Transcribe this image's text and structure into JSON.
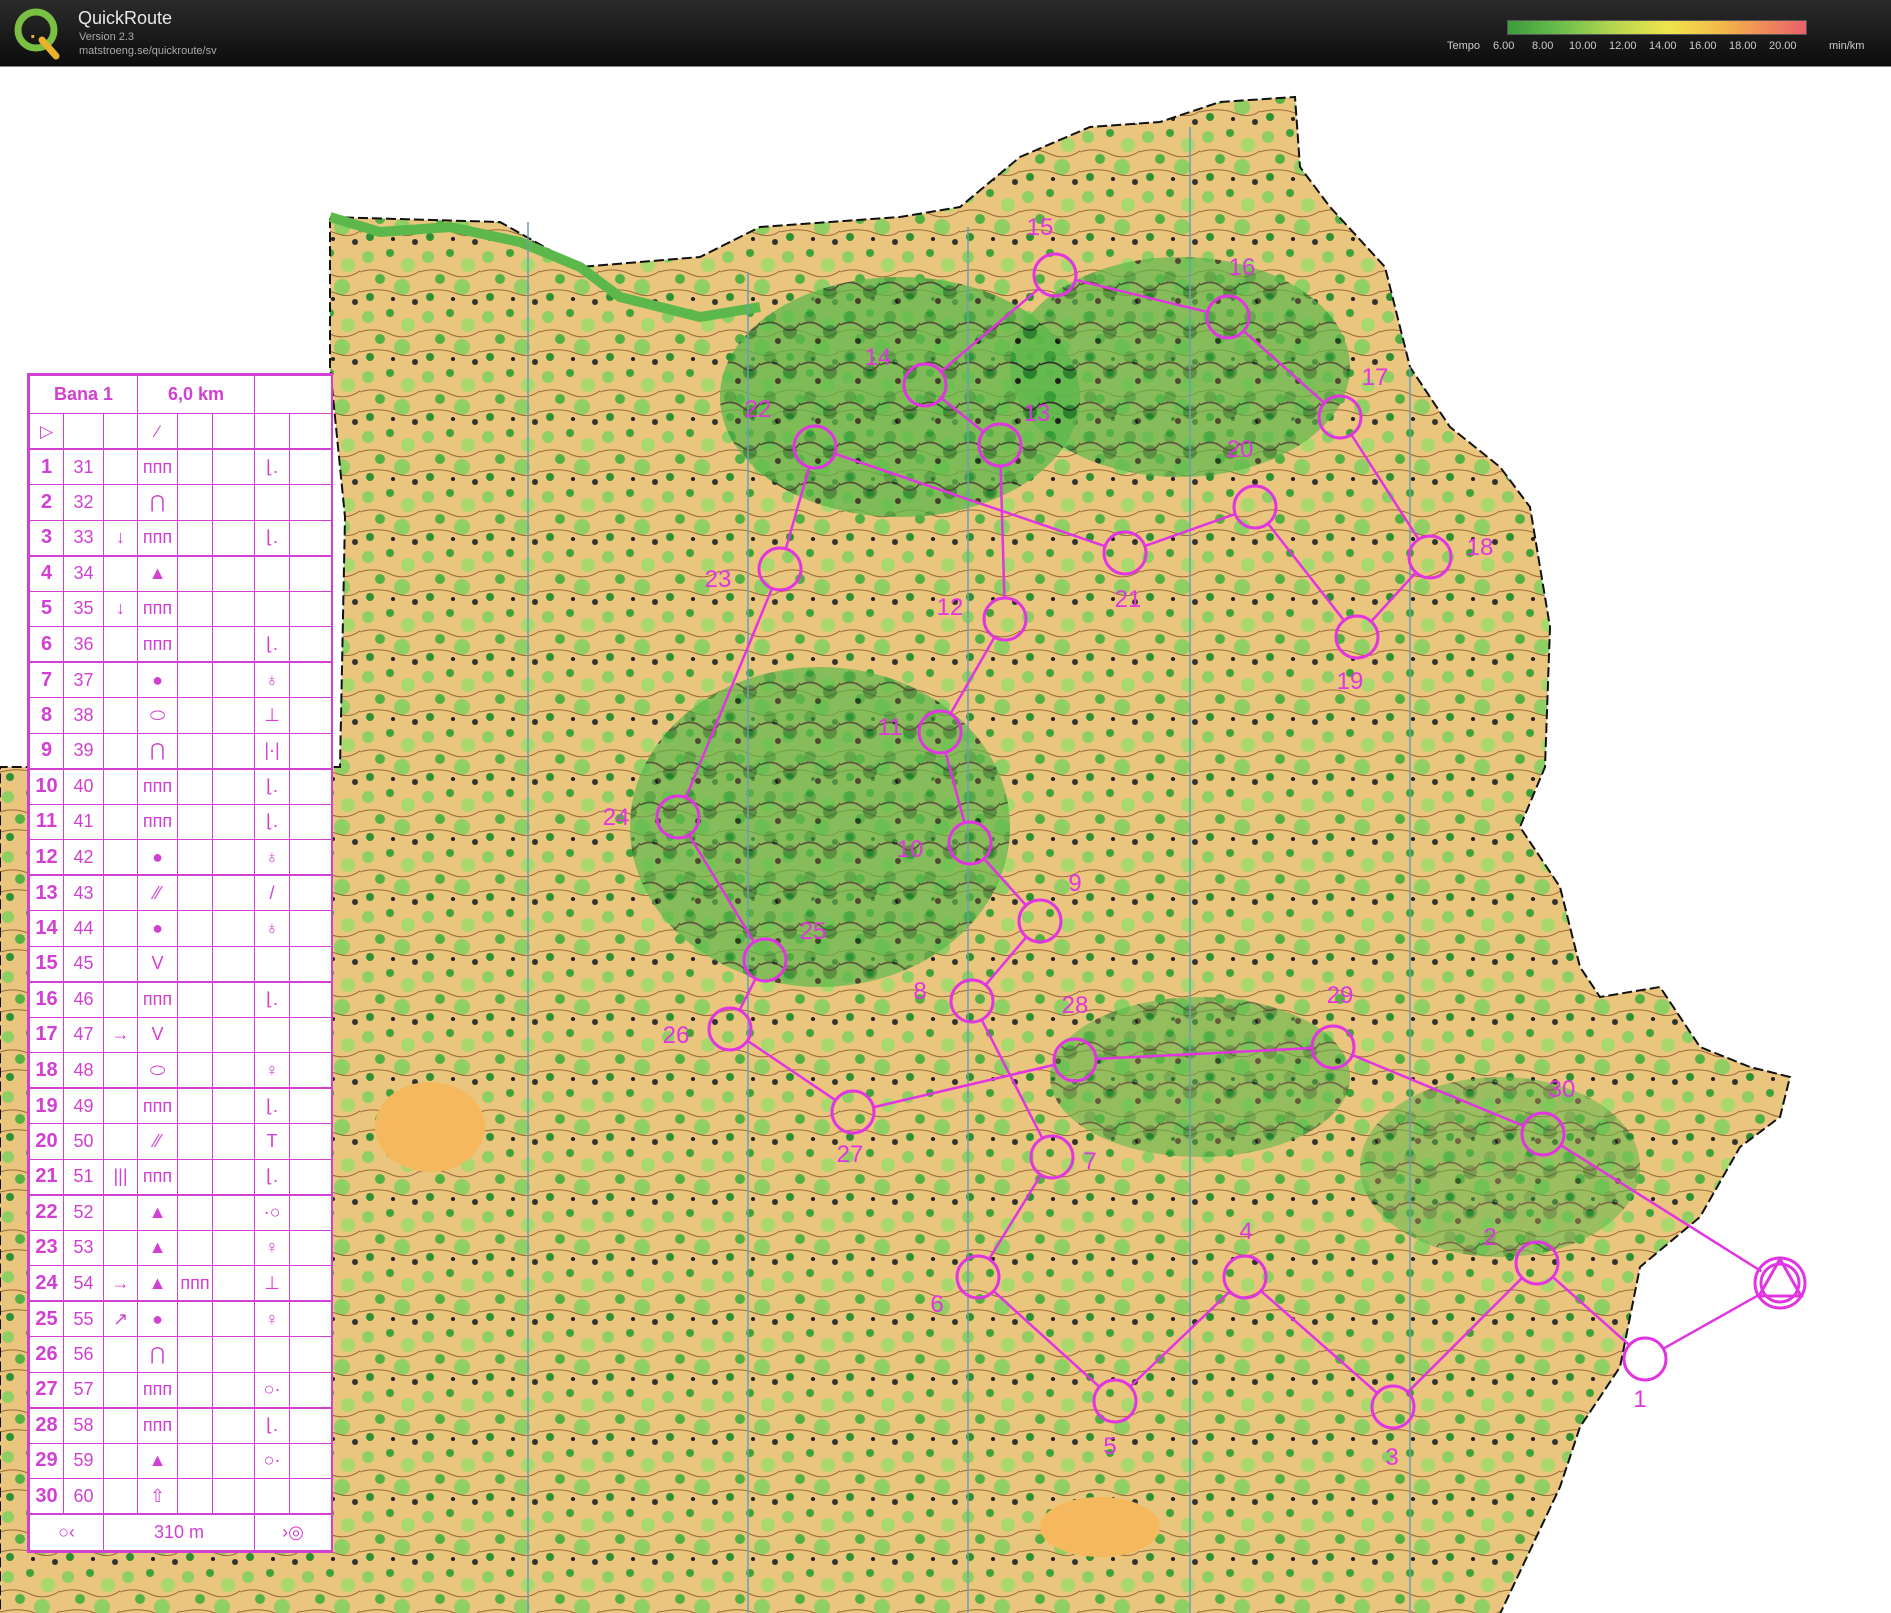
{
  "header": {
    "app_name": "QuickRoute",
    "version": "Version 2.3",
    "url": "matstroeng.se/quickroute/sv",
    "tempo_label": "Tempo",
    "tempo_ticks": [
      "6.00",
      "8.00",
      "10.00",
      "12.00",
      "14.00",
      "16.00",
      "18.00",
      "20.00"
    ],
    "tempo_unit": "min/km"
  },
  "course": {
    "name": "Bana 1",
    "length": "6,0 km",
    "finish_distance": "310 m",
    "controls": [
      {
        "n": "1",
        "code": "31",
        "c": "",
        "d": "ᴨᴨᴨ",
        "e": "",
        "g": "⌊."
      },
      {
        "n": "2",
        "code": "32",
        "c": "",
        "d": "⋂",
        "e": "",
        "g": ""
      },
      {
        "n": "3",
        "code": "33",
        "c": "↓",
        "d": "ᴨᴨᴨ",
        "e": "",
        "g": "⌊."
      },
      {
        "n": "4",
        "code": "34",
        "c": "",
        "d": "▲",
        "e": "",
        "g": ""
      },
      {
        "n": "5",
        "code": "35",
        "c": "↓",
        "d": "ᴨᴨᴨ",
        "e": "",
        "g": ""
      },
      {
        "n": "6",
        "code": "36",
        "c": "",
        "d": "ᴨᴨᴨ",
        "e": "",
        "g": "⌊."
      },
      {
        "n": "7",
        "code": "37",
        "c": "",
        "d": "●",
        "e": "",
        "g": "♁"
      },
      {
        "n": "8",
        "code": "38",
        "c": "",
        "d": "⬭",
        "e": "",
        "g": "⊥"
      },
      {
        "n": "9",
        "code": "39",
        "c": "",
        "d": "⋂",
        "e": "",
        "g": "|·|"
      },
      {
        "n": "10",
        "code": "40",
        "c": "",
        "d": "ᴨᴨᴨ",
        "e": "",
        "g": "⌊."
      },
      {
        "n": "11",
        "code": "41",
        "c": "",
        "d": "ᴨᴨᴨ",
        "e": "",
        "g": "⌊."
      },
      {
        "n": "12",
        "code": "42",
        "c": "",
        "d": "●",
        "e": "",
        "g": "♁"
      },
      {
        "n": "13",
        "code": "43",
        "c": "",
        "d": "⁄⁄",
        "e": "",
        "g": "/"
      },
      {
        "n": "14",
        "code": "44",
        "c": "",
        "d": "●",
        "e": "",
        "g": "♁"
      },
      {
        "n": "15",
        "code": "45",
        "c": "",
        "d": "V",
        "e": "",
        "g": ""
      },
      {
        "n": "16",
        "code": "46",
        "c": "",
        "d": "ᴨᴨᴨ",
        "e": "",
        "g": "⌊."
      },
      {
        "n": "17",
        "code": "47",
        "c": "→",
        "d": "V",
        "e": "",
        "g": ""
      },
      {
        "n": "18",
        "code": "48",
        "c": "",
        "d": "⬭",
        "e": "",
        "g": "♀"
      },
      {
        "n": "19",
        "code": "49",
        "c": "",
        "d": "ᴨᴨᴨ",
        "e": "",
        "g": "⌊."
      },
      {
        "n": "20",
        "code": "50",
        "c": "",
        "d": "⁄⁄",
        "e": "",
        "g": "T"
      },
      {
        "n": "21",
        "code": "51",
        "c": "|||",
        "d": "ᴨᴨᴨ",
        "e": "",
        "g": "⌊."
      },
      {
        "n": "22",
        "code": "52",
        "c": "",
        "d": "▲",
        "e": "",
        "g": "·○"
      },
      {
        "n": "23",
        "code": "53",
        "c": "",
        "d": "▲",
        "e": "",
        "g": "♀"
      },
      {
        "n": "24",
        "code": "54",
        "c": "→",
        "d": "▲",
        "e": "ᴨᴨᴨ",
        "g": "⊥"
      },
      {
        "n": "25",
        "code": "55",
        "c": "↗",
        "d": "●",
        "e": "",
        "g": "♀"
      },
      {
        "n": "26",
        "code": "56",
        "c": "",
        "d": "⋂",
        "e": "",
        "g": ""
      },
      {
        "n": "27",
        "code": "57",
        "c": "",
        "d": "ᴨᴨᴨ",
        "e": "",
        "g": "○·"
      },
      {
        "n": "28",
        "code": "58",
        "c": "",
        "d": "ᴨᴨᴨ",
        "e": "",
        "g": "⌊."
      },
      {
        "n": "29",
        "code": "59",
        "c": "",
        "d": "▲",
        "e": "",
        "g": "○·"
      },
      {
        "n": "30",
        "code": "60",
        "c": "",
        "d": "⇧",
        "e": "",
        "g": ""
      }
    ]
  },
  "map_controls": [
    {
      "label": "1"
    },
    {
      "label": "2"
    },
    {
      "label": "3"
    },
    {
      "label": "4"
    },
    {
      "label": "5"
    },
    {
      "label": "6"
    },
    {
      "label": "7"
    },
    {
      "label": "8"
    },
    {
      "label": "9"
    },
    {
      "label": "10"
    },
    {
      "label": "11"
    },
    {
      "label": "12"
    },
    {
      "label": "13"
    },
    {
      "label": "14"
    },
    {
      "label": "15"
    },
    {
      "label": "16"
    },
    {
      "label": "17"
    },
    {
      "label": "18"
    },
    {
      "label": "19"
    },
    {
      "label": "20"
    },
    {
      "label": "21"
    },
    {
      "label": "22"
    },
    {
      "label": "23"
    },
    {
      "label": "24"
    },
    {
      "label": "25"
    },
    {
      "label": "26"
    },
    {
      "label": "27"
    },
    {
      "label": "28"
    },
    {
      "label": "29"
    },
    {
      "label": "30"
    }
  ],
  "colors": {
    "course": "#e035e0",
    "terrain_open": "#f7c47c",
    "terrain_forest": "#7cc45a",
    "terrain_dense": "#2e9a35",
    "header_bg": "#111111"
  }
}
